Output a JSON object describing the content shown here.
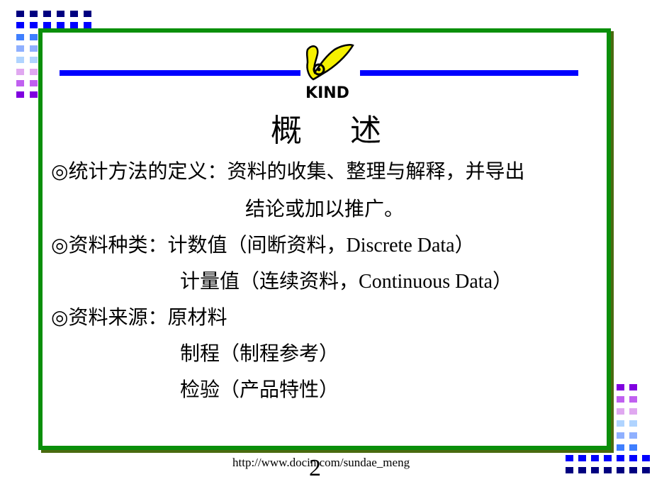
{
  "slide": {
    "title_chars": [
      "概",
      "述"
    ],
    "logo_text": "KIND",
    "bullet_symbol": "◎",
    "items": [
      {
        "label": "统计方法的定义：",
        "lines": [
          "资料的收集、整理与解释，并导出",
          "结论或加以推广。"
        ]
      },
      {
        "label": "资料种类：",
        "lines": [
          {
            "zh": "计数值（间断资料，",
            "en": "Discrete Data",
            "close": "）"
          },
          {
            "zh": "计量值（连续资料，",
            "en": "Continuous Data",
            "close": "）"
          }
        ]
      },
      {
        "label": "资料来源：",
        "lines": [
          "原材料",
          "制程（制程参考）",
          "检验（产品特性）"
        ]
      }
    ],
    "page_number": "2",
    "footer_url": "http://www.docin.com/sundae_meng"
  },
  "colors": {
    "frame": "#0a8f0a",
    "rule": "#0000ff",
    "logo_yellow": "#f5f000",
    "square_rows": [
      "#000080",
      "#0000ff",
      "#3f7fff",
      "#8fb0ff",
      "#b0d4ff",
      "#e0a8f0",
      "#c060f0",
      "#8000e0"
    ]
  }
}
